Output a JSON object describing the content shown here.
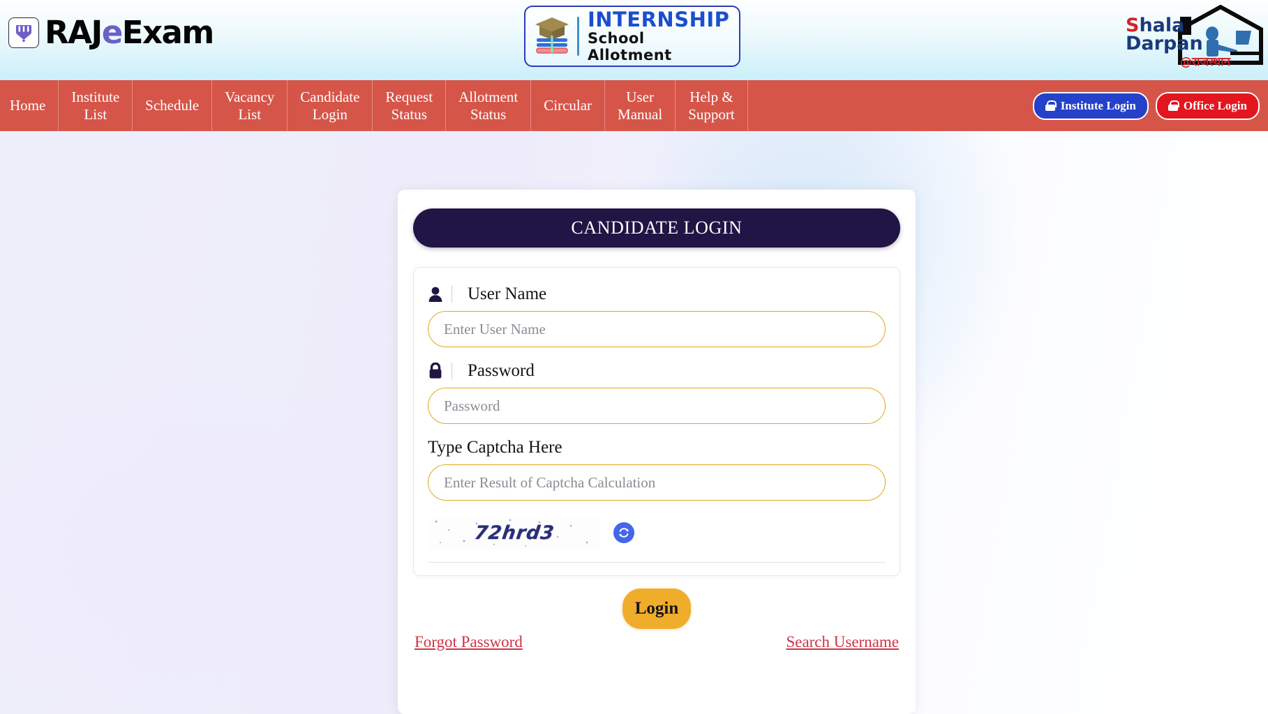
{
  "header": {
    "brand_left": {
      "text_raj": "RAJ",
      "text_e": "e",
      "text_exam": "Exam",
      "badge_icon": "crown-pencil-icon"
    },
    "center_logo": {
      "line1": "INTERNSHIP",
      "line2": "School Allotment",
      "icon": "graduation-cap-books-icon"
    },
    "brand_right": {
      "line1_first": "S",
      "line1_rest": "hala",
      "line2": "Darpan",
      "hindi": "@राजस्थान",
      "icon": "school-house-icon"
    }
  },
  "nav": {
    "items": [
      {
        "label": "Home",
        "name": "home"
      },
      {
        "label": "Institute\nList",
        "name": "institute-list"
      },
      {
        "label": "Schedule",
        "name": "schedule"
      },
      {
        "label": "Vacancy\nList",
        "name": "vacancy-list"
      },
      {
        "label": "Candidate\nLogin",
        "name": "candidate-login"
      },
      {
        "label": "Request\nStatus",
        "name": "request-status"
      },
      {
        "label": "Allotment\nStatus",
        "name": "allotment-status"
      },
      {
        "label": "Circular",
        "name": "circular"
      },
      {
        "label": "User\nManual",
        "name": "user-manual"
      },
      {
        "label": "Help &\nSupport",
        "name": "help-support"
      }
    ],
    "institute_login": "Institute Login",
    "office_login": "Office Login"
  },
  "login_card": {
    "title": "CANDIDATE LOGIN",
    "username": {
      "label": "User Name",
      "placeholder": "Enter User Name",
      "value": "",
      "icon": "user-icon"
    },
    "password": {
      "label": "Password",
      "placeholder": "Password",
      "value": "",
      "icon": "lock-icon"
    },
    "captcha": {
      "label": "Type Captcha Here",
      "placeholder": "Enter Result of Captcha Calculation",
      "value": "",
      "image_text": "72hrd3",
      "refresh_icon": "refresh-icon"
    },
    "submit_label": "Login",
    "forgot_password": "Forgot Password",
    "search_username": "Search Username"
  },
  "colors": {
    "navbar": "#d65549",
    "card_header": "#201544",
    "input_border": "#e0a81f",
    "submit": "#f0ad2b",
    "link": "#cf3346",
    "institute_btn": "#2540c9",
    "office_btn": "#e3161f",
    "captcha_text": "#2a2f7a",
    "refresh_btn": "#4466e8"
  }
}
